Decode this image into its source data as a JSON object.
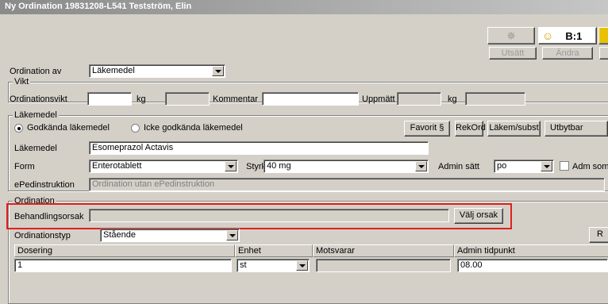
{
  "window": {
    "title": "Ny Ordination 19831208-L541 Testström, Elin"
  },
  "toolbar": {
    "badge_label": "B:1",
    "utsatt_label": "Utsätt",
    "andra_label": "Ändra"
  },
  "ordination_av": {
    "label": "Ordination av",
    "value": "Läkemedel"
  },
  "vikt": {
    "legend": "Vikt",
    "ordinationsvikt_label": "Ordinationsvikt",
    "ordinationsvikt_value": "",
    "kg_label": "kg",
    "kommentar_label": "Kommentar",
    "kommentar_value": "",
    "uppmatt_label": "Uppmätt vikt",
    "uppmatt_kg_label": "kg"
  },
  "lakemedel": {
    "legend": "Läkemedel",
    "radio_godkanda": "Godkända läkemedel",
    "radio_icke": "Icke godkända läkemedel",
    "favorit_label": "Favorit §",
    "rekord_label": "RekOrd",
    "lakem_subst_label": "Läkem/subst",
    "utbytbar_label": "Utbytbar",
    "lakemedel_label": "Läkemedel",
    "lakemedel_value": "Esomeprazol Actavis",
    "form_label": "Form",
    "form_value": "Enterotablett",
    "styrka_label": "Styrka",
    "styrka_value": "40 mg",
    "admin_satt_label": "Admin sätt",
    "admin_satt_value": "po",
    "adm_som_label": "Adm som",
    "epedinstruktion_label": "ePedinstruktion",
    "epedinstruktion_value": "Ordination utan ePedinstruktion"
  },
  "ordination": {
    "legend": "Ordination",
    "behandlingsorsak_label": "Behandlingsorsak",
    "behandlingsorsak_value": "",
    "valj_orsak_label": "Välj orsak",
    "ordinationstyp_label": "Ordinationstyp",
    "ordinationstyp_value": "Stående",
    "r_button_label": "R",
    "table_headers": {
      "dosering": "Dosering",
      "enhet": "Enhet",
      "motsvarar": "Motsvarar",
      "admin_tidpunkt": "Admin tidpunkt"
    },
    "row": {
      "dosering": "1",
      "enhet": "st",
      "motsvarar": "",
      "admin_tidpunkt": "08.00"
    }
  }
}
